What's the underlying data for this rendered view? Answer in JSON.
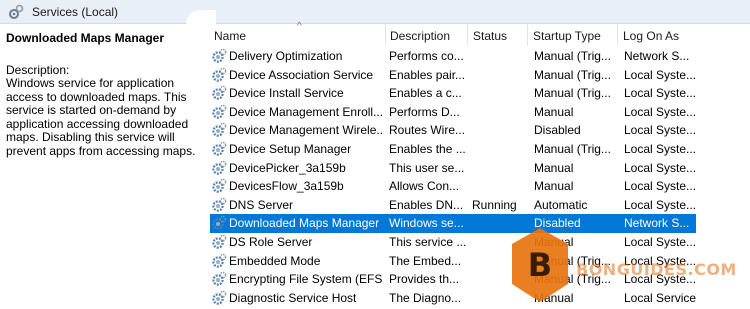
{
  "window": {
    "title": "Services (Local)",
    "icon": "services-gear-icon"
  },
  "left_pane": {
    "service_name": "Downloaded Maps Manager",
    "description_label": "Description:",
    "description": "Windows service for application access to downloaded maps. This service is started on-demand by application accessing downloaded maps. Disabling this service will prevent apps from accessing maps."
  },
  "columns": {
    "name": "Name",
    "description": "Description",
    "status": "Status",
    "startup_type": "Startup Type",
    "log_on_as": "Log On As"
  },
  "rows": [
    {
      "name": "Delivery Optimization",
      "description": "Performs co...",
      "status": "",
      "startup": "Manual (Trig...",
      "logon": "Network S..."
    },
    {
      "name": "Device Association Service",
      "description": "Enables pair...",
      "status": "",
      "startup": "Manual (Trig...",
      "logon": "Local Syste..."
    },
    {
      "name": "Device Install Service",
      "description": "Enables a c...",
      "status": "",
      "startup": "Manual (Trig...",
      "logon": "Local Syste..."
    },
    {
      "name": "Device Management Enroll...",
      "description": "Performs D...",
      "status": "",
      "startup": "Manual",
      "logon": "Local Syste..."
    },
    {
      "name": "Device Management Wirele...",
      "description": "Routes Wire...",
      "status": "",
      "startup": "Disabled",
      "logon": "Local Syste..."
    },
    {
      "name": "Device Setup Manager",
      "description": "Enables the ...",
      "status": "",
      "startup": "Manual (Trig...",
      "logon": "Local Syste..."
    },
    {
      "name": "DevicePicker_3a159b",
      "description": "This user se...",
      "status": "",
      "startup": "Manual",
      "logon": "Local Syste..."
    },
    {
      "name": "DevicesFlow_3a159b",
      "description": "Allows Con...",
      "status": "",
      "startup": "Manual",
      "logon": "Local Syste..."
    },
    {
      "name": "DNS Server",
      "description": "Enables DN...",
      "status": "Running",
      "startup": "Automatic",
      "logon": "Local Syste..."
    },
    {
      "name": "Downloaded Maps Manager",
      "description": "Windows se...",
      "status": "",
      "startup": "Disabled",
      "logon": "Network S...",
      "selected": true
    },
    {
      "name": "DS Role Server",
      "description": "This service ...",
      "status": "",
      "startup": "Manual",
      "logon": "Local Syste..."
    },
    {
      "name": "Embedded Mode",
      "description": "The Embed...",
      "status": "",
      "startup": "Manual (Trig...",
      "logon": "Local Syste..."
    },
    {
      "name": "Encrypting File System (EFS)",
      "description": "Provides th...",
      "status": "",
      "startup": "Manual (Trig...",
      "logon": "Local Syste..."
    },
    {
      "name": "Diagnostic Service Host",
      "description": "The Diagno...",
      "status": "",
      "startup": "Manual",
      "logon": "Local Service"
    }
  ],
  "watermark": {
    "text": "BONGUIDES.COM",
    "logo_letter": "B",
    "color": "#e8740f"
  },
  "colors": {
    "selection": "#0078d7",
    "titlebar": "#e9eff7"
  }
}
